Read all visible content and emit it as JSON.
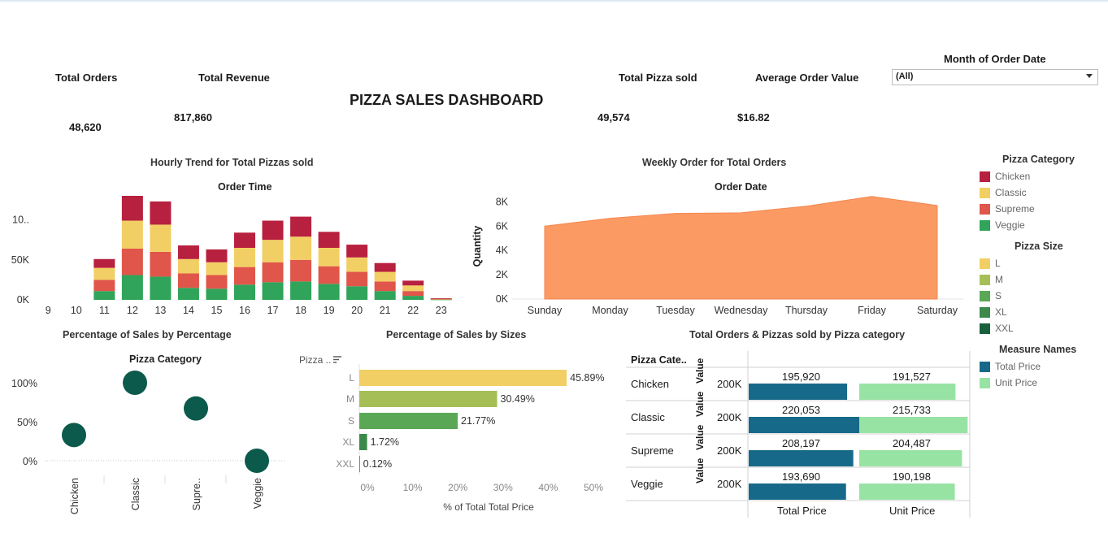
{
  "header": {
    "title": "PIZZA SALES DASHBOARD",
    "kpis": [
      {
        "label": "Total Orders",
        "value": "48,620"
      },
      {
        "label": "Total Revenue",
        "value": "817,860"
      },
      {
        "label": "Total Pizza sold",
        "value": "49,574"
      },
      {
        "label": "Average Order Value",
        "value": "$16.82"
      }
    ],
    "filter": {
      "label": "Month of Order Date",
      "value": "(All)"
    }
  },
  "legends": {
    "category": {
      "title": "Pizza Category",
      "items": [
        {
          "label": "Chicken",
          "color": "#b8203f"
        },
        {
          "label": "Classic",
          "color": "#f2cf64"
        },
        {
          "label": "Supreme",
          "color": "#e0564a"
        },
        {
          "label": "Veggie",
          "color": "#2fa45a"
        }
      ]
    },
    "size": {
      "title": "Pizza Size",
      "items": [
        {
          "label": "L",
          "color": "#f2cf64"
        },
        {
          "label": "M",
          "color": "#a5bf56"
        },
        {
          "label": "S",
          "color": "#5aa855"
        },
        {
          "label": "XL",
          "color": "#3b8a4b"
        },
        {
          "label": "XXL",
          "color": "#17603c"
        }
      ]
    },
    "measure": {
      "title": "Measure Names",
      "items": [
        {
          "label": "Total Price",
          "color": "#17698a"
        },
        {
          "label": "Unit Price",
          "color": "#97e3a4"
        }
      ]
    }
  },
  "chart_data": [
    {
      "id": "hourly",
      "type": "bar",
      "title": "Hourly Trend for Total Pizzas sold",
      "xlabel": "Order Time",
      "ylabel": "",
      "categories": [
        "9",
        "10",
        "11",
        "12",
        "13",
        "14",
        "15",
        "16",
        "17",
        "18",
        "19",
        "20",
        "21",
        "22",
        "23"
      ],
      "ytick_labels": [
        "0K",
        "50K",
        "10.."
      ],
      "ytick_values": [
        0,
        50000,
        100000
      ],
      "ylim": [
        0,
        130000
      ],
      "series": [
        {
          "name": "Veggie",
          "values": [
            0,
            0,
            11000,
            31000,
            29000,
            15000,
            14000,
            19000,
            22000,
            23000,
            20000,
            17000,
            11000,
            5000,
            500
          ]
        },
        {
          "name": "Supreme",
          "values": [
            0,
            0,
            14000,
            33000,
            31000,
            18000,
            17000,
            22000,
            25000,
            27000,
            22000,
            18000,
            12000,
            6000,
            500
          ]
        },
        {
          "name": "Classic",
          "values": [
            0,
            0,
            15000,
            35000,
            34000,
            18000,
            16000,
            24000,
            28000,
            29000,
            23000,
            18000,
            12000,
            7000,
            500
          ]
        },
        {
          "name": "Chicken",
          "values": [
            0,
            0,
            11000,
            31000,
            29000,
            17000,
            16000,
            19000,
            24000,
            25000,
            20000,
            16000,
            11000,
            6000,
            500
          ]
        }
      ]
    },
    {
      "id": "weekly",
      "type": "area",
      "title": "Weekly Order for Total Orders",
      "xlabel": "Order Date",
      "ylabel": "Quantity",
      "categories": [
        "Sunday",
        "Monday",
        "Tuesday",
        "Wednesday",
        "Thursday",
        "Friday",
        "Saturday"
      ],
      "values": [
        6000,
        6650,
        7050,
        7100,
        7650,
        8450,
        7700
      ],
      "ytick_labels": [
        "0K",
        "2K",
        "4K",
        "6K",
        "8K"
      ],
      "ytick_values": [
        0,
        2000,
        4000,
        6000,
        8000
      ],
      "ylim": [
        0,
        8700
      ]
    },
    {
      "id": "category_pct",
      "type": "scatter",
      "title": "Percentage of Sales by Percentage",
      "xlabel": "Pizza Category",
      "ylabel": "",
      "categories": [
        "Chicken",
        "Classic",
        "Supre..",
        "Veggie"
      ],
      "values": [
        33,
        100,
        67,
        0
      ],
      "ytick_labels": [
        "0%",
        "50%",
        "100%"
      ],
      "ytick_values": [
        0,
        50,
        100
      ]
    },
    {
      "id": "size_pct",
      "type": "bar",
      "title": "Percentage of Sales by Sizes",
      "column_header": "Pizza ..",
      "xlabel": "% of Total Total Price",
      "categories": [
        "L",
        "M",
        "S",
        "XL",
        "XXL"
      ],
      "values": [
        45.89,
        30.49,
        21.77,
        1.72,
        0.12
      ],
      "value_labels": [
        "45.89%",
        "30.49%",
        "21.77%",
        "1.72%",
        "0.12%"
      ],
      "xtick_labels": [
        "0%",
        "10%",
        "20%",
        "30%",
        "40%",
        "50%"
      ],
      "xlim": [
        0,
        50
      ]
    },
    {
      "id": "orders_category",
      "type": "bar",
      "title": "Total Orders & Pizzas sold by Pizza category",
      "row_header": "Pizza Cate..",
      "axis_label": "Value",
      "axis_tick": "200K",
      "categories": [
        "Chicken",
        "Classic",
        "Supreme",
        "Veggie"
      ],
      "columns": [
        "Total Price",
        "Unit Price"
      ],
      "series": [
        {
          "name": "Total Price",
          "values": [
            195920,
            220053,
            208197,
            193690
          ],
          "labels": [
            "195,920",
            "220,053",
            "208,197",
            "193,690"
          ]
        },
        {
          "name": "Unit Price",
          "values": [
            191527,
            215733,
            204487,
            190198
          ],
          "labels": [
            "191,527",
            "215,733",
            "204,487",
            "190,198"
          ]
        }
      ]
    }
  ]
}
